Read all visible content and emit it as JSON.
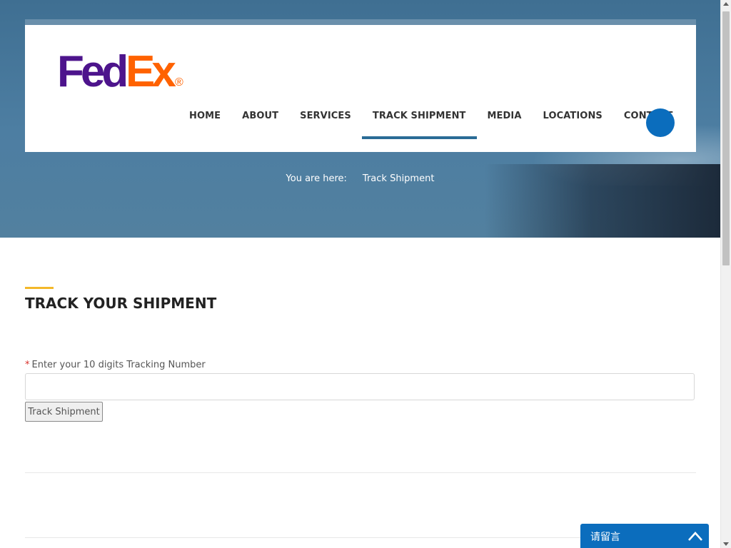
{
  "brand": {
    "logo_fed": "Fed",
    "logo_ex": "Ex",
    "logo_mark": "®",
    "color_purple": "#4d148c",
    "color_orange": "#ff6200"
  },
  "nav": {
    "items": [
      {
        "label": "HOME"
      },
      {
        "label": "ABOUT"
      },
      {
        "label": "SERVICES"
      },
      {
        "label": "TRACK SHIPMENT",
        "active": true
      },
      {
        "label": "MEDIA"
      },
      {
        "label": "LOCATIONS"
      },
      {
        "label": "CONTACT"
      }
    ],
    "search_icon": "search-icon"
  },
  "breadcrumb": {
    "prefix": "You are here:",
    "current": "Track Shipment"
  },
  "section": {
    "title": "TRACK YOUR SHIPMENT"
  },
  "form": {
    "required_marker": "*",
    "label": "Enter your 10 digits Tracking Number",
    "input_value": "",
    "button_label": "Track Shipment"
  },
  "chat": {
    "label": "请留言",
    "expand_icon": "expand-icon"
  },
  "colors": {
    "accent_blue": "#0b6dbd",
    "accent_yellow": "#f3b82a",
    "hero_blue": "#4d7ea2"
  }
}
